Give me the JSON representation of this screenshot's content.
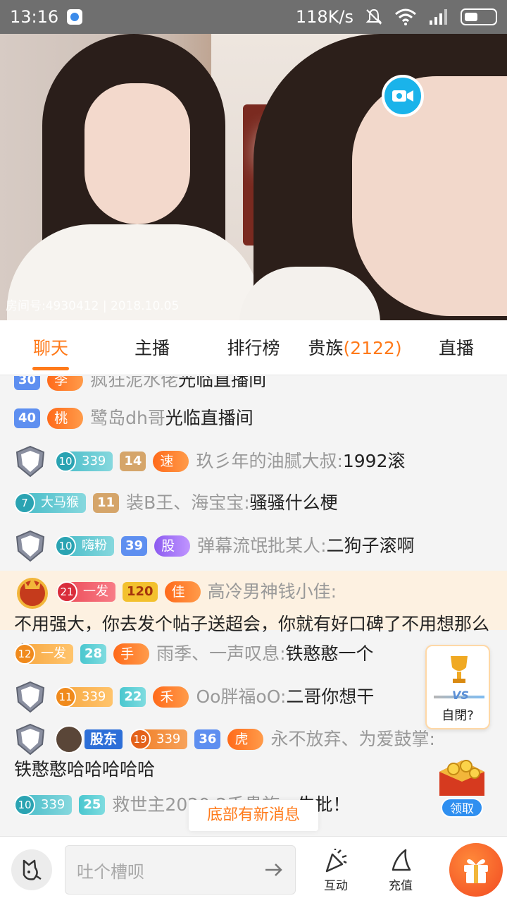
{
  "status_bar": {
    "time": "13:16",
    "network_speed": "118K/s",
    "icons": [
      "app-icon",
      "mute-icon",
      "wifi-icon",
      "signal-icon",
      "battery-icon"
    ]
  },
  "video": {
    "room_info": "房间号:4930412 | 2018.10.05",
    "camera_icon": "video-camera-icon"
  },
  "tabs": [
    {
      "label": "聊天",
      "active": true
    },
    {
      "label": "主播"
    },
    {
      "label": "排行榜"
    },
    {
      "label": "贵族",
      "count": "(2122)"
    },
    {
      "label": "直播"
    }
  ],
  "chat": {
    "messages": [
      {
        "badges": [
          "30",
          "李"
        ],
        "user": "疯狂泥水佬",
        "text": "光临直播间"
      },
      {
        "badges": [
          "40",
          "桃"
        ],
        "user": "鹭岛dh哥",
        "text": "光临直播间"
      },
      {
        "badges": [
          "侠",
          "10",
          "339",
          "14",
          "速"
        ],
        "user": "玖彡年的油腻大叔:",
        "text": "1992滚"
      },
      {
        "badges": [
          "7",
          "大马猴",
          "11"
        ],
        "user": "装B王、海宝宝:",
        "text": "骚骚什么梗"
      },
      {
        "badges": [
          "侠",
          "10",
          "嗨粉",
          "39",
          "股"
        ],
        "user": "弹幕流氓批某人:",
        "text": "二狗子滚啊"
      },
      {
        "badges": [
          "皇",
          "21",
          "一发",
          "120",
          "佳"
        ],
        "user": "高冷男神钱小佳:",
        "text": " 不用强大，你去发个帖子送超会，你就有好口碑了不用想那么多"
      },
      {
        "badges": [
          "12",
          "一发",
          "28",
          "手"
        ],
        "user": "雨季、一声叹息:",
        "text": "铁憨憨一个"
      },
      {
        "badges": [
          "侠",
          "11",
          "339",
          "22",
          "禾"
        ],
        "user": "Oo胖福oO:",
        "text": "二哥你想干"
      },
      {
        "badges": [
          "侠",
          "股东",
          "19",
          "339",
          "36",
          "虎"
        ],
        "user": "永不放弃、为爱鼓掌:",
        "text": "铁憨憨哈哈哈哈哈"
      },
      {
        "badges": [
          "10",
          "339",
          "25"
        ],
        "user": "救世主2020:2千贵族",
        "text": "，牛批！"
      }
    ],
    "new_message_notice": "底部有新消息"
  },
  "widgets": {
    "vs_label": "自閉?",
    "vs_text": "VS",
    "chest_label": "领取"
  },
  "bottom_bar": {
    "input_placeholder": "吐个槽呗",
    "interact_label": "互动",
    "recharge_label": "充值"
  },
  "colors": {
    "accent": "#ff7a1a",
    "highlight_row": "#fdf1e1",
    "camera_button": "#1ab3ea"
  }
}
